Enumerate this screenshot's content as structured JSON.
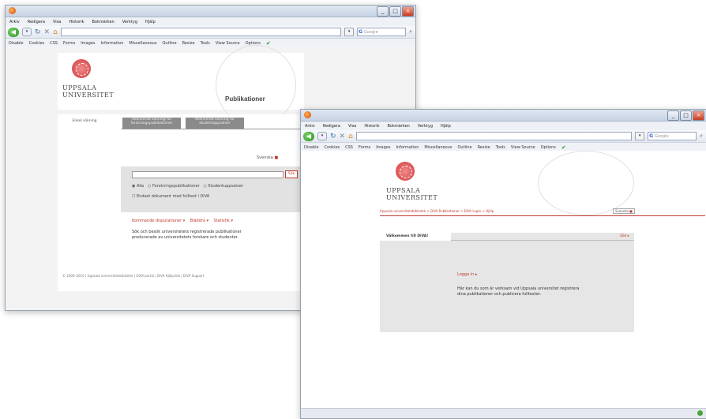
{
  "browser": {
    "menu": [
      "Arkiv",
      "Redigera",
      "Visa",
      "Historik",
      "Bokmärken",
      "Verktyg",
      "Hjälp"
    ],
    "google_placeholder": "Google",
    "devbar": [
      "Disable",
      "Cookies",
      "CSS",
      "Forms",
      "Images",
      "Information",
      "Miscellaneous",
      "Outline",
      "Resize",
      "Tools",
      "View Source",
      "Options"
    ],
    "win_buttons": [
      "_",
      "□",
      "×"
    ]
  },
  "win1": {
    "logo_line1": "UPPSALA",
    "logo_line2": "UNIVERSITET",
    "page_title": "Publikationer",
    "tabs": [
      "Enkel sökning",
      "Avancerad sökning för forskningspublikationer",
      "Avancerad sökning för studentuppsatser"
    ],
    "language_link": "Svenska",
    "search_button": "Sök",
    "radio_options": [
      "Alla",
      "Forskningspublikationer",
      "Studentuppsatser"
    ],
    "checkbox_label": "Endast dokument med fulltext i DiVA",
    "links": [
      "Kommande disputationer",
      "Bläddra",
      "Statistik"
    ],
    "description": "Sök och besök universitetets registrerade publikationer producerade av universitetets forskare och studenter.",
    "footer": "© 2000–2010 | Uppsala universitetsbibliotek | DiVA-portal | DiVA Hjälpsida | DiVA Support"
  },
  "win2": {
    "logo_line1": "UPPSALA",
    "logo_line2": "UNIVERSITET",
    "breadcrumb": "Uppsala universitetsbibliotek > DiVA Publikationer > DiVA Login > Hjälp",
    "lang_box": "Svenska",
    "welcome": "Välkommen till DiVA!",
    "top_link": "Sök",
    "login_link": "Logga in",
    "login_text": "Här kan du som är verksam vid Uppsala universitet registrera dina publikationer och publicera fulltexter."
  },
  "colors": {
    "accent_red": "#c0392b",
    "chrome_blue": "#c7d3e4"
  }
}
